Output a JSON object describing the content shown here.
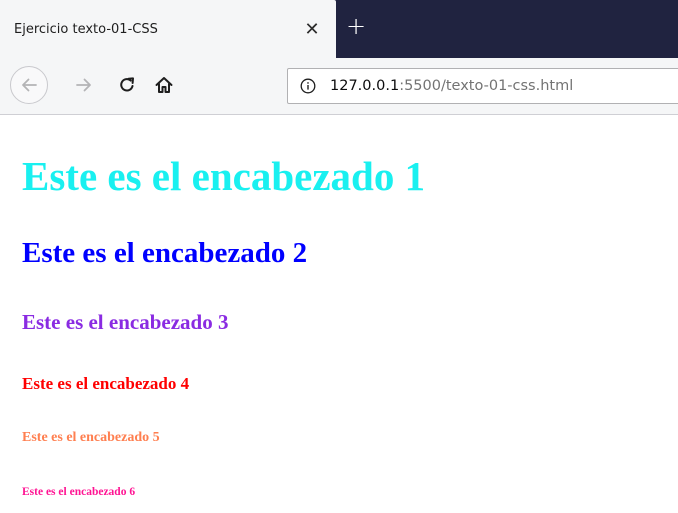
{
  "tab": {
    "title": "Ejercicio texto-01-CSS",
    "close_glyph": "✕",
    "new_tab_glyph": "+"
  },
  "toolbar": {
    "back_icon": "back-arrow-icon",
    "forward_icon": "forward-arrow-icon",
    "reload_icon": "reload-icon",
    "home_icon": "home-icon",
    "url_host": "127.0.0.1",
    "url_rest": ":5500/texto-01-css.html"
  },
  "headings": [
    {
      "text": "Este es el encabezado 1",
      "color": "#19f0f0"
    },
    {
      "text": "Este es el encabezado 2",
      "color": "#0000ff"
    },
    {
      "text": "Este es el encabezado 3",
      "color": "#8a2be2"
    },
    {
      "text": "Este es el encabezado 4",
      "color": "#ff0000"
    },
    {
      "text": "Este es el encabezado 5",
      "color": "#ff7f50"
    },
    {
      "text": "Este es el encabezado 6",
      "color": "#ff1493"
    }
  ],
  "colors": {
    "tabstrip_bg": "#202340",
    "toolbar_bg": "#f5f6f7"
  }
}
